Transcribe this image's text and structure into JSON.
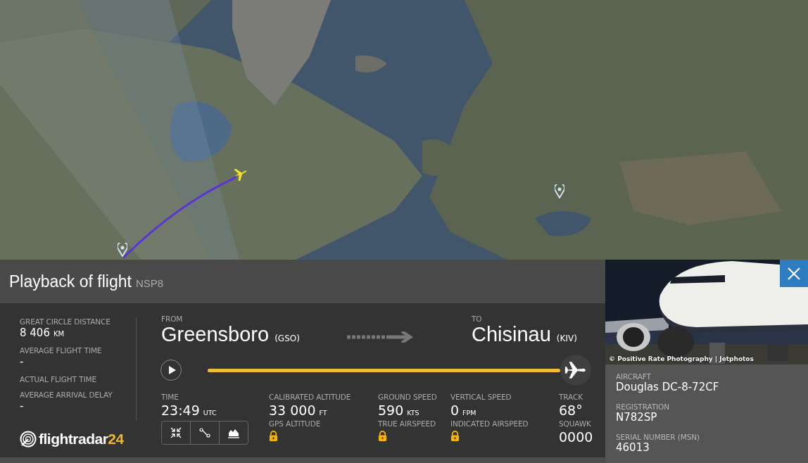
{
  "flight": {
    "title": "Playback of flight",
    "callsign": "NSP8"
  },
  "stats": [
    {
      "label": "GREAT CIRCLE DISTANCE",
      "value": "8 406",
      "unit": "KM"
    },
    {
      "label": "AVERAGE FLIGHT TIME",
      "value": "-"
    },
    {
      "label": "ACTUAL FLIGHT TIME"
    },
    {
      "label": "AVERAGE ARRIVAL DELAY",
      "value": "-"
    }
  ],
  "logo": {
    "name": "flightradar",
    "suffix": "24"
  },
  "route": {
    "from": {
      "label": "FROM",
      "city": "Greensboro",
      "code": "(GSO)"
    },
    "to": {
      "label": "TO",
      "city": "Chisinau",
      "code": "(KIV)"
    }
  },
  "playback": {
    "playing": false,
    "level": 1
  },
  "readouts": [
    {
      "kind": "time",
      "label": "TIME",
      "value": "23:49",
      "unit": "UTC"
    },
    {
      "kind": "metric",
      "label": "CALIBRATED ALTITUDE",
      "value": "33 000",
      "unit": "FT",
      "sub": {
        "label": "GPS ALTITUDE",
        "locked": true
      }
    },
    {
      "kind": "metric",
      "label": "GROUND SPEED",
      "value": "590",
      "unit": "KTS",
      "sub": {
        "label": "TRUE AIRSPEED",
        "locked": true
      }
    },
    {
      "kind": "metric",
      "label": "VERTICAL SPEED",
      "value": "0",
      "unit": "FPM",
      "sub": {
        "label": "INDICATED AIRSPEED",
        "locked": true
      }
    },
    {
      "kind": "metric",
      "label": "TRACK",
      "value": "68°",
      "sub": {
        "label": "SQUAWK",
        "locked": false,
        "value": "0000"
      }
    }
  ],
  "aircraft": {
    "photo_credit": "© Positive Rate Photography | Jetphotos",
    "fields": [
      {
        "label": "AIRCRAFT",
        "value": "Douglas DC-8-72CF"
      },
      {
        "label": "REGISTRATION",
        "value": "N782SP"
      },
      {
        "label": "SERIAL NUMBER (MSN)",
        "value": "46013"
      }
    ]
  }
}
